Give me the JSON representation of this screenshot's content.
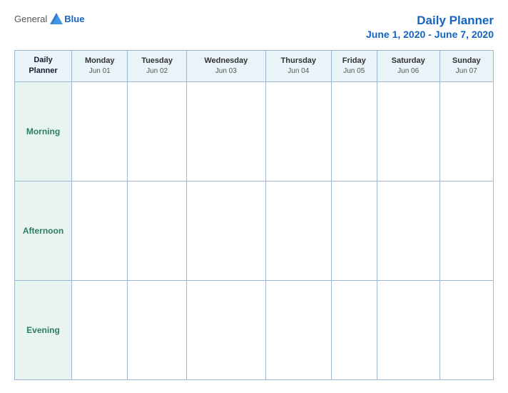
{
  "header": {
    "logo_general": "General",
    "logo_blue": "Blue",
    "title": "Daily Planner",
    "date_range": "June 1, 2020 - June 7, 2020"
  },
  "table": {
    "label_column_header": [
      "Daily",
      "Planner"
    ],
    "days": [
      {
        "name": "Monday",
        "date": "Jun 01"
      },
      {
        "name": "Tuesday",
        "date": "Jun 02"
      },
      {
        "name": "Wednesday",
        "date": "Jun 03"
      },
      {
        "name": "Thursday",
        "date": "Jun 04"
      },
      {
        "name": "Friday",
        "date": "Jun 05"
      },
      {
        "name": "Saturday",
        "date": "Jun 06"
      },
      {
        "name": "Sunday",
        "date": "Jun 07"
      }
    ],
    "rows": [
      {
        "label": "Morning"
      },
      {
        "label": "Afternoon"
      },
      {
        "label": "Evening"
      }
    ]
  }
}
